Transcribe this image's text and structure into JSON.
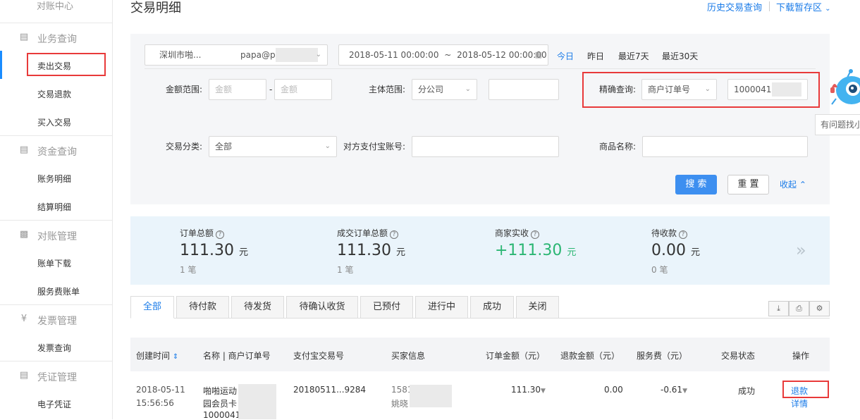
{
  "sidebar": {
    "top_label": "对账中心",
    "groups": [
      {
        "icon": "document-icon",
        "label": "业务查询",
        "items": [
          "卖出交易",
          "交易退款",
          "买入交易"
        ]
      },
      {
        "icon": "document-icon",
        "label": "资金查询",
        "items": [
          "账务明细",
          "结算明细"
        ]
      },
      {
        "icon": "bar-chart-icon",
        "label": "对账管理",
        "items": [
          "账单下载",
          "服务费账单"
        ]
      },
      {
        "icon": "yen-icon",
        "label": "发票管理",
        "items": [
          "发票查询"
        ]
      },
      {
        "icon": "voucher-icon",
        "label": "凭证管理",
        "items": [
          "电子凭证"
        ]
      }
    ],
    "active_item": "卖出交易"
  },
  "header": {
    "title": "交易明细",
    "history_link": "历史交易查询",
    "download_link": "下载暂存区"
  },
  "filters": {
    "account_name": "深圳市啪...",
    "account_email": "papa@pa",
    "date_start": "2018-05-11 00:00:00",
    "date_sep": "~",
    "date_end": "2018-05-12 00:00:00",
    "quick_dates": [
      "今日",
      "昨日",
      "最近7天",
      "最近30天"
    ],
    "amount_label": "金额范围:",
    "amount_min_placeholder": "金额",
    "amount_sep": "-",
    "amount_max_placeholder": "金额",
    "entity_label": "主体范围:",
    "entity_value": "分公司",
    "exact_label": "精确查询:",
    "exact_type": "商户订单号",
    "exact_value": "10000411",
    "category_label": "交易分类:",
    "category_value": "全部",
    "counterparty_label": "对方支付宝账号:",
    "product_label": "商品名称:",
    "search_button": "搜 索",
    "reset_button": "重 置",
    "collapse_link": "收起"
  },
  "summary": {
    "items": [
      {
        "label": "订单总额",
        "value": "111.30",
        "unit": "元",
        "count": "1 笔",
        "color": "#333333"
      },
      {
        "label": "成交订单总额",
        "value": "111.30",
        "unit": "元",
        "count": "1 笔",
        "color": "#333333"
      },
      {
        "label": "商家实收",
        "value": "+111.30",
        "unit": "元",
        "count": "",
        "color": "#2bb673"
      },
      {
        "label": "待收款",
        "value": "0.00",
        "unit": "元",
        "count": "0 笔",
        "color": "#333333"
      }
    ]
  },
  "tabs": [
    "全部",
    "待付款",
    "待发货",
    "待确认收货",
    "已预付",
    "进行中",
    "成功",
    "关闭"
  ],
  "active_tab": "全部",
  "table": {
    "headers": [
      "创建时间",
      "名称 | 商户订单号",
      "支付宝交易号",
      "买家信息",
      "订单金额（元）",
      "退款金额（元）",
      "服务费（元）",
      "交易状态",
      "操作"
    ],
    "rows": [
      {
        "date": "2018-05-11",
        "time": "15:56:56",
        "name_line1": "啪啪运动",
        "name_line2": "园会员卡",
        "name_line3": "10000411",
        "trade_no": "20180511...9284",
        "buyer_line1": "1581",
        "buyer_line2": "姚晓",
        "amount": "111.30",
        "refund": "0.00",
        "fee": "-0.61",
        "status": "成功",
        "action_refund": "退款",
        "action_detail": "详情"
      }
    ]
  },
  "helper": {
    "tooltip": "有问题找小"
  },
  "colors": {
    "accent": "#1a7be8",
    "highlight_box": "#e83a3a",
    "success_green": "#2bb673"
  }
}
